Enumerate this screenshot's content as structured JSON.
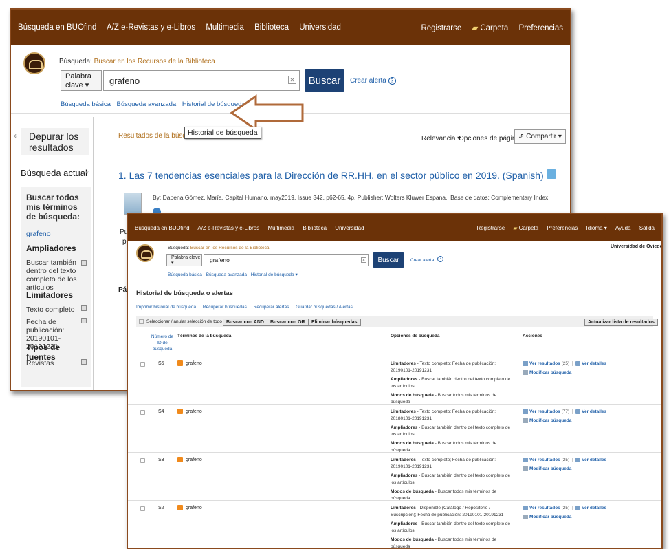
{
  "back": {
    "nav": [
      "Búsqueda en BUOfind",
      "A/Z e-Revistas y e-Libros",
      "Multimedia",
      "Biblioteca",
      "Universidad"
    ],
    "nav_right": [
      "Registrarse",
      "Carpeta",
      "Preferencias"
    ],
    "search_label": "Búsqueda:",
    "search_scope": "Buscar en los Recursos de la Biblioteca",
    "field_select": "Palabra clave ▾",
    "query": "grafeno",
    "search_button": "Buscar",
    "alert": "Crear alerta",
    "links": [
      "Búsqueda básica",
      "Búsqueda avanzada",
      "Historial de búsqueda ▸"
    ],
    "tooltip": "Historial de búsqueda",
    "results_label": "Resultados de la búsqueda:",
    "sort": "Relevancia ▾",
    "page_options": "Opciones de página ▾",
    "share": "Compartir ▾",
    "collapse": "«",
    "sidebar": {
      "title": "Depurar los resultados",
      "current": "Búsqueda actual",
      "find_all": "Buscar todos mis términos de búsqueda:",
      "term": "grafeno",
      "expanders_title": "Ampliadores",
      "expander": "Buscar también dentro del texto completo de los artículos",
      "limiters_title": "Limitadores",
      "limiter1": "Texto completo",
      "limiter2": "Fecha de publicación: 20190101-20191231",
      "source_title": "Tipos de fuentes",
      "source1": "Revistas"
    },
    "result1": {
      "title": "1. Las 7 tendencias esenciales para la Dirección de RR.HH. en el sector público en 2019. (Spanish)",
      "meta": "By: Dapena Gómez, María. Capital Humano, may2019, Issue 342, p62-65, 4p. Publisher: Wolters Kluwer Espana., Base de datos: Complementary Index"
    },
    "partial_left": [
      "Pu",
      "p",
      "Pág"
    ]
  },
  "front": {
    "nav": [
      "Búsqueda en BUOfind",
      "A/Z e-Revistas y e-Libros",
      "Multimedia",
      "Biblioteca",
      "Universidad"
    ],
    "nav_right": [
      "Registrarse",
      "Carpeta",
      "Preferencias",
      "Idioma ▾",
      "Ayuda",
      "Salida"
    ],
    "institution": "Universidad de Oviedo",
    "search_label": "Búsqueda:",
    "search_scope": "Buscar en los Recursos de la Biblioteca",
    "field_select": "Palabra clave ▾",
    "query": "grafeno",
    "search_button": "Buscar",
    "alert": "Crear alerta",
    "links": [
      "Búsqueda básica",
      "Búsqueda avanzada",
      "Historial de búsqueda ▾"
    ],
    "heading": "Historial de búsqueda o alertas",
    "actions": [
      "Imprimir historial de búsqueda",
      "Recuperar búsquedas",
      "Recuperar alertas",
      "Guardar búsquedas / Alertas"
    ],
    "select_all": "Seleccionar / anular selección de todo",
    "btn_and": "Buscar con AND",
    "btn_or": "Buscar con OR",
    "btn_delete": "Eliminar búsquedas",
    "btn_refresh": "Actualizar lista de resultados",
    "col_id": "Número de ID de búsqueda",
    "col_terms": "Términos de la búsqueda",
    "col_options": "Opciones de búsqueda",
    "col_actions": "Acciones",
    "rows": [
      {
        "id": "S5",
        "term": "grafeno",
        "lim": "Texto completo; Fecha de publicación: 20190101-20191231",
        "amp": "Buscar también dentro del texto completo de los artículos",
        "mod": "Buscar todos mis términos de búsqueda",
        "view": "Ver resultados",
        "count": "(25)"
      },
      {
        "id": "S4",
        "term": "grafeno",
        "lim": "Texto completo; Fecha de publicación: 20180101-20191231",
        "amp": "Buscar también dentro del texto completo de los artículos",
        "mod": "Buscar todos mis términos de búsqueda",
        "view": "Ver resultados",
        "count": "(77)"
      },
      {
        "id": "S3",
        "term": "grafeno",
        "lim": "Texto completo; Fecha de publicación: 20190101-20191231",
        "amp": "Buscar también dentro del texto completo de los artículos",
        "mod": "Buscar todos mis términos de búsqueda",
        "view": "Ver resultados",
        "count": "(25)"
      },
      {
        "id": "S2",
        "term": "grafeno",
        "lim": "Disponible (Catálogo / Repositorio / Suscripción); Fecha de publicación: 20190101-20191231",
        "amp": "Buscar también dentro del texto completo de los artículos",
        "mod": "Buscar todos mis términos de búsqueda",
        "view": "Ver resultados",
        "count": "(25)"
      }
    ],
    "labels": {
      "lim": "Limitadores",
      "amp": "Ampliadores",
      "mod": "Modos de búsqueda",
      "details": "Ver detalles",
      "modify": "Modificar búsqueda",
      "dash": " - "
    }
  }
}
